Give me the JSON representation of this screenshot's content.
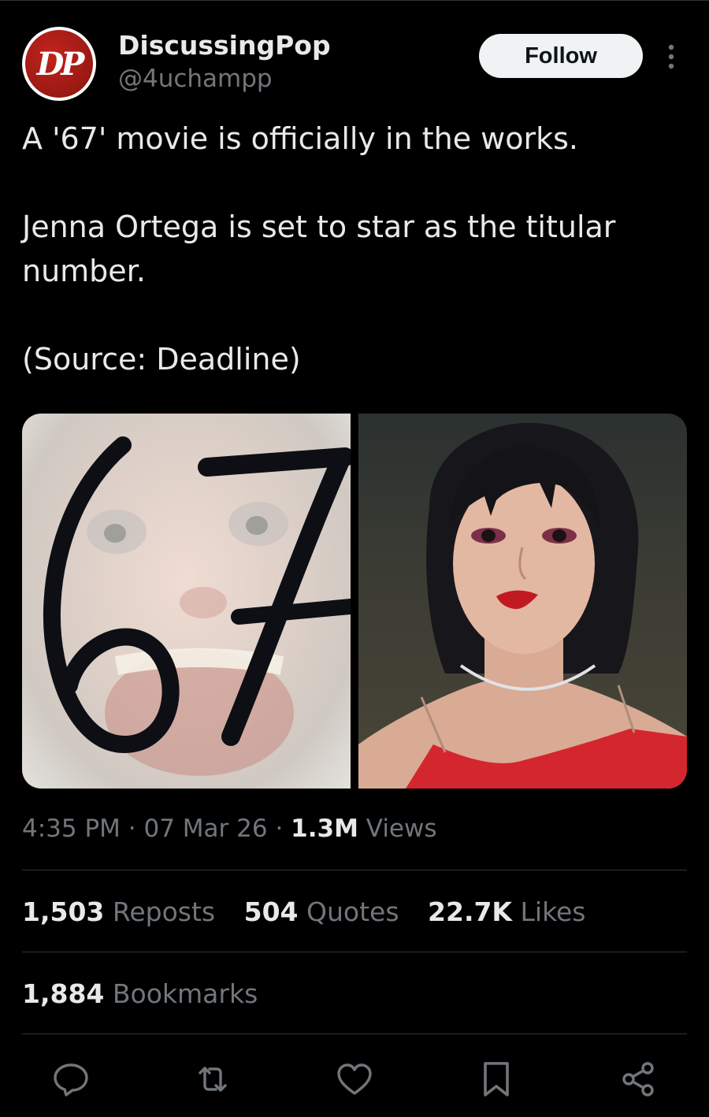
{
  "author": {
    "display_name": "DiscussingPop",
    "handle": "@4uchampp",
    "avatar_text": "DP",
    "follow_label": "Follow"
  },
  "tweet": {
    "line1": "A '67' movie is officially in the works.",
    "line2": "Jenna Ortega is set to star as the titular number.",
    "line3": "(Source: Deadline)"
  },
  "media": {
    "left_overlay_text": "67"
  },
  "meta": {
    "time": "4:35 PM",
    "separator": "·",
    "date": "07 Mar 26",
    "views_count": "1.3M",
    "views_label": "Views"
  },
  "stats": {
    "reposts_count": "1,503",
    "reposts_label": "Reposts",
    "quotes_count": "504",
    "quotes_label": "Quotes",
    "likes_count": "22.7K",
    "likes_label": "Likes",
    "bookmarks_count": "1,884",
    "bookmarks_label": "Bookmarks"
  },
  "colors": {
    "background": "#000000",
    "text_primary": "#e7e9ea",
    "text_secondary": "#71767b",
    "divider": "#2f3336",
    "avatar_red": "#b01e18"
  },
  "icons": [
    "more-vertical-icon",
    "reply-icon",
    "repost-icon",
    "like-icon",
    "bookmark-icon",
    "share-icon"
  ]
}
